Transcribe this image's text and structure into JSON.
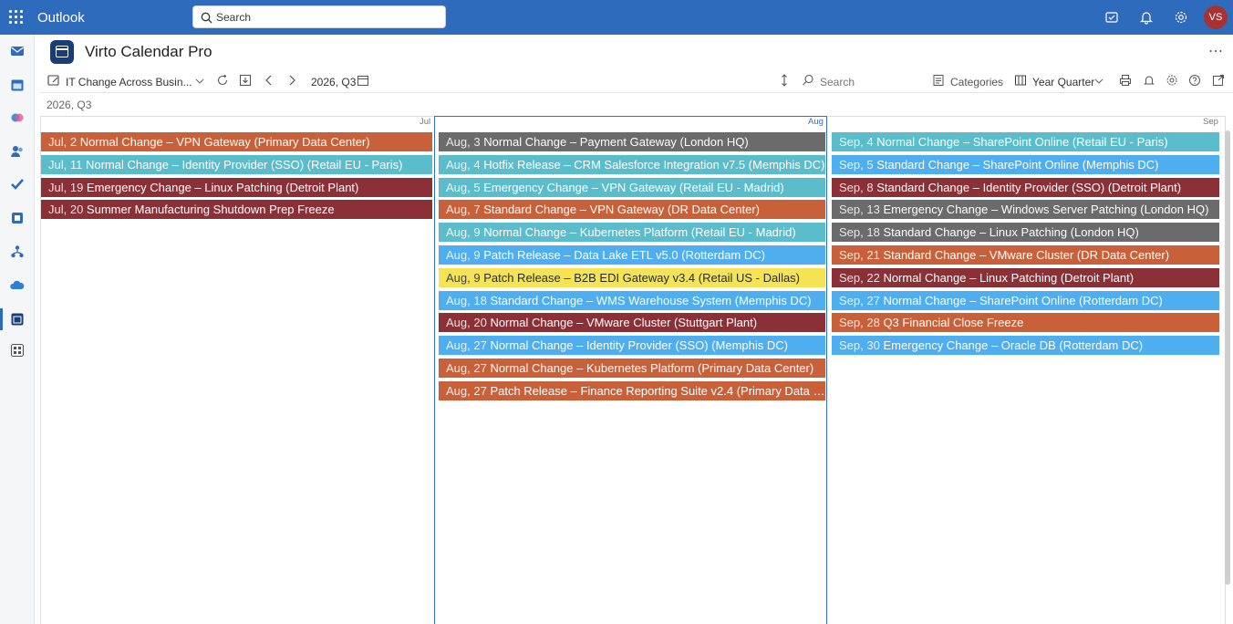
{
  "topbar": {
    "app_title": "Outlook",
    "search_placeholder": "Search",
    "avatar_initials": "VS"
  },
  "app": {
    "name": "Virto Calendar Pro"
  },
  "toolbar": {
    "calendar_select": "IT Change Across Busin...",
    "period": "2026, Q3",
    "search_placeholder": "Search",
    "categories_label": "Categories",
    "view_label": "Year Quarter"
  },
  "range_label": "2026, Q3",
  "months": [
    "Jul",
    "Aug",
    "Sep"
  ],
  "colors": {
    "orange": "#c8603a",
    "teal": "#5bbdcc",
    "maroon": "#8a3036",
    "blue": "#4eaef0",
    "gray": "#6b6b6b",
    "yellow": "#f4e455"
  },
  "events": {
    "jul": [
      {
        "date": "Jul, 2",
        "title": "Normal Change – VPN Gateway (Primary Data Center)",
        "color": "#c8603a"
      },
      {
        "date": "Jul, 11",
        "title": "Normal Change – Identity Provider (SSO) (Retail EU - Paris)",
        "color": "#5bbdcc"
      },
      {
        "date": "Jul, 19",
        "title": "Emergency Change – Linux Patching (Detroit Plant)",
        "color": "#8a3036"
      },
      {
        "date": "Jul, 20",
        "title": "Summer Manufacturing Shutdown Prep Freeze",
        "color": "#8a3036"
      }
    ],
    "aug": [
      {
        "date": "Aug, 3",
        "title": "Normal Change – Payment Gateway (London HQ)",
        "color": "#6b6b6b"
      },
      {
        "date": "Aug, 4",
        "title": "Hotfix Release – CRM Salesforce Integration v7.5 (Memphis DC)",
        "color": "#5bbdcc"
      },
      {
        "date": "Aug, 5",
        "title": "Emergency Change – VPN Gateway (Retail EU - Madrid)",
        "color": "#5bbdcc"
      },
      {
        "date": "Aug, 7",
        "title": "Standard Change – VPN Gateway (DR Data Center)",
        "color": "#c8603a"
      },
      {
        "date": "Aug, 9",
        "title": "Normal Change – Kubernetes Platform (Retail EU - Madrid)",
        "color": "#5bbdcc"
      },
      {
        "date": "Aug, 9",
        "title": "Patch Release – Data Lake ETL v5.0 (Rotterdam DC)",
        "color": "#4eaef0"
      },
      {
        "date": "Aug, 9",
        "title": "Patch Release – B2B EDI Gateway v3.4 (Retail US - Dallas)",
        "color": "#f4e455",
        "dark": true
      },
      {
        "date": "Aug, 18",
        "title": "Standard Change – WMS Warehouse System (Memphis DC)",
        "color": "#4eaef0"
      },
      {
        "date": "Aug, 20",
        "title": "Normal Change – VMware Cluster (Stuttgart Plant)",
        "color": "#8a3036"
      },
      {
        "date": "Aug, 27",
        "title": "Normal Change – Identity Provider (SSO) (Memphis DC)",
        "color": "#4eaef0"
      },
      {
        "date": "Aug, 27",
        "title": "Normal Change – Kubernetes Platform (Primary Data Center)",
        "color": "#c8603a"
      },
      {
        "date": "Aug, 27",
        "title": "Patch Release – Finance Reporting Suite v2.4 (Primary Data Cent...",
        "color": "#c8603a"
      }
    ],
    "sep": [
      {
        "date": "Sep, 4",
        "title": "Normal Change – SharePoint Online (Retail EU - Paris)",
        "color": "#5bbdcc"
      },
      {
        "date": "Sep, 5",
        "title": "Standard Change – SharePoint Online (Memphis DC)",
        "color": "#4eaef0"
      },
      {
        "date": "Sep, 8",
        "title": "Standard Change – Identity Provider (SSO) (Detroit Plant)",
        "color": "#8a3036"
      },
      {
        "date": "Sep, 13",
        "title": "Emergency Change – Windows Server Patching (London HQ)",
        "color": "#6b6b6b"
      },
      {
        "date": "Sep, 18",
        "title": "Standard Change – Linux Patching (London HQ)",
        "color": "#6b6b6b"
      },
      {
        "date": "Sep, 21",
        "title": "Standard Change – VMware Cluster (DR Data Center)",
        "color": "#c8603a"
      },
      {
        "date": "Sep, 22",
        "title": "Normal Change – Linux Patching (Detroit Plant)",
        "color": "#8a3036"
      },
      {
        "date": "Sep, 27",
        "title": "Normal Change – SharePoint Online (Rotterdam DC)",
        "color": "#4eaef0"
      },
      {
        "date": "Sep, 28",
        "title": "Q3 Financial Close Freeze",
        "color": "#c8603a"
      },
      {
        "date": "Sep, 30",
        "title": "Emergency Change – Oracle DB (Rotterdam DC)",
        "color": "#4eaef0"
      }
    ]
  }
}
